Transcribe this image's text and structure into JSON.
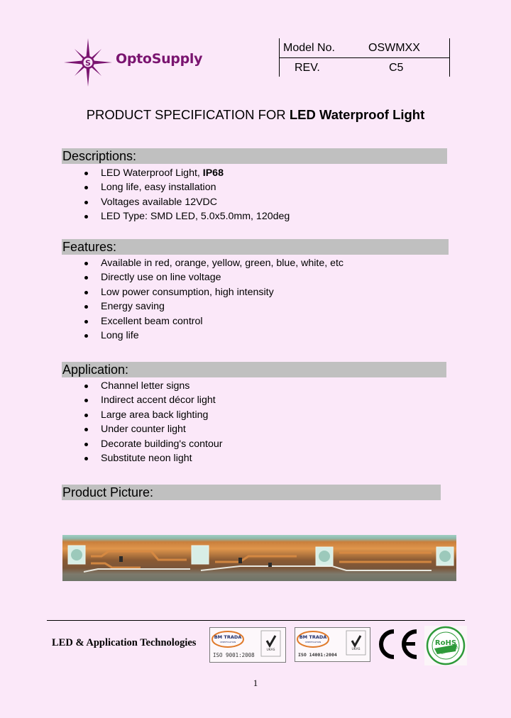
{
  "header": {
    "logo_text": "OptoSupply",
    "model_label": "Model No.",
    "model_value": "OSWMXX",
    "rev_label": "REV.",
    "rev_value": "C5"
  },
  "title": {
    "prefix": "PRODUCT SPECIFICATION FOR ",
    "product": "LED Waterproof Light"
  },
  "sections": {
    "descriptions": {
      "heading": "Descriptions:",
      "items": [
        {
          "text": "LED Waterproof Light, ",
          "bold": "IP68"
        },
        {
          "text": "Long life, easy installation"
        },
        {
          "text": "Voltages available 12VDC"
        },
        {
          "text": "LED Type: SMD LED, 5.0x5.0mm, 120deg"
        }
      ]
    },
    "features": {
      "heading": "Features:",
      "items": [
        {
          "text": "Available in red, orange, yellow, green, blue, white, etc"
        },
        {
          "text": "Directly use on line voltage"
        },
        {
          "text": "Low power consumption, high intensity"
        },
        {
          "text": "Energy saving"
        },
        {
          "text": "Excellent beam control"
        },
        {
          "text": "Long life"
        }
      ]
    },
    "application": {
      "heading": "Application:",
      "items": [
        {
          "text": "Channel letter signs"
        },
        {
          "text": "Indirect accent décor light"
        },
        {
          "text": "Large area back lighting"
        },
        {
          "text": "Under counter light"
        },
        {
          "text": "Decorate building's contour"
        },
        {
          "text": "Substitute neon light"
        }
      ]
    },
    "product_picture": {
      "heading": "Product Picture:"
    }
  },
  "footer": {
    "company": "LED & Application Technologies",
    "certs": [
      {
        "org": "BM TRADA",
        "sub": "CERTIFICATION",
        "standard": "ISO 9001:2008",
        "ukas": "UKAS"
      },
      {
        "org": "BM TRADA",
        "sub": "CERTIFICATION",
        "standard": "ISO 14001:2004",
        "ukas": "UKAS"
      }
    ],
    "ce_mark": "CE",
    "rohs": {
      "top": "RoHS",
      "sub": "Compliant"
    },
    "page_number": "1"
  },
  "colors": {
    "background": "#fbe8f9",
    "brand_purple": "#7a1470",
    "section_bar": "#c0c0c0",
    "rohs_green": "#2e9a3a"
  }
}
